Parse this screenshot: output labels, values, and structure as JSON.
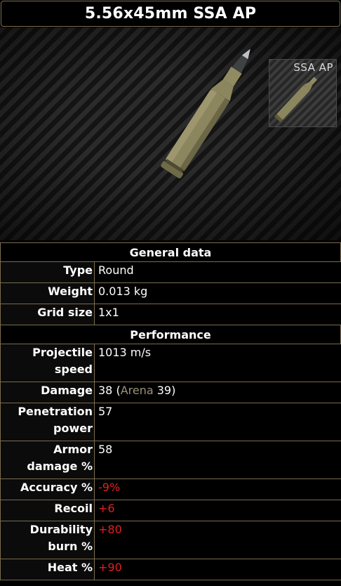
{
  "title": "5.56x45mm SSA AP",
  "thumbnail_label": "SSA AP",
  "colors": {
    "border": "#7a6c4f",
    "negative": "#e02020",
    "arena": "#9c927a"
  },
  "general": {
    "header": "General data",
    "rows": [
      {
        "label": "Type",
        "value": "Round"
      },
      {
        "label": "Weight",
        "value": "0.013 kg"
      },
      {
        "label": "Grid size",
        "value": "1x1"
      }
    ]
  },
  "performance": {
    "header": "Performance",
    "projectile_speed": {
      "label_line1": "Projectile",
      "label_line2": "speed",
      "value": "1013 m/s"
    },
    "damage": {
      "label": "Damage",
      "value": "38 (",
      "arena_label": "Arena",
      "arena_value": " 39)"
    },
    "penetration": {
      "label_line1": "Penetration",
      "label_line2": "power",
      "value": "57"
    },
    "armor_damage": {
      "label_line1": "Armor",
      "label_line2": "damage %",
      "value": "58"
    },
    "accuracy": {
      "label": "Accuracy %",
      "value": "-9%"
    },
    "recoil": {
      "label": "Recoil",
      "value": "+6"
    },
    "durability": {
      "label_line1": "Durability",
      "label_line2": "burn %",
      "value": "+80"
    },
    "heat": {
      "label": "Heat %",
      "value": "+90"
    }
  }
}
